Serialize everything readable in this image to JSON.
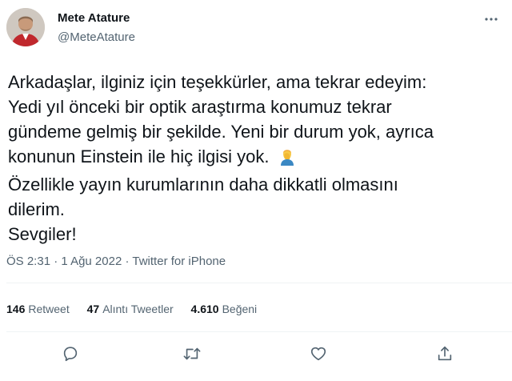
{
  "author": {
    "name": "Mete Atature",
    "handle": "@MeteAtature",
    "avatar": "avatar-photo"
  },
  "more_icon": "more-options-icon",
  "tweet": {
    "lines": [
      "Arkadaşlar, ilginiz için teşekkürler, ama tekrar edeyim:",
      "Yedi yıl önceki bir optik araştırma konumuz tekrar",
      "gündeme gelmiş bir şekilde. Yeni bir durum yok, ayrıca",
      "konunun Einstein ile hiç ilgisi yok.",
      "Özellikle yayın kurumlarının daha dikkatli olmasını",
      "dilerim.",
      "Sevgiler!"
    ],
    "emoji": "facepalm-emoji"
  },
  "meta": {
    "time": "ÖS 2:31",
    "separator": "·",
    "date": "1 Ağu 2022",
    "source": "Twitter for iPhone"
  },
  "stats": {
    "retweets": {
      "count": "146",
      "label": "Retweet"
    },
    "quotes": {
      "count": "47",
      "label": "Alıntı Tweetler"
    },
    "likes": {
      "count": "4.610",
      "label": "Beğeni"
    }
  },
  "actions": {
    "reply": "reply-icon",
    "retweet": "retweet-icon",
    "like": "like-icon",
    "share": "share-icon"
  },
  "colors": {
    "text": "#0f1419",
    "secondary": "#536471",
    "divider": "#eff3f4"
  }
}
